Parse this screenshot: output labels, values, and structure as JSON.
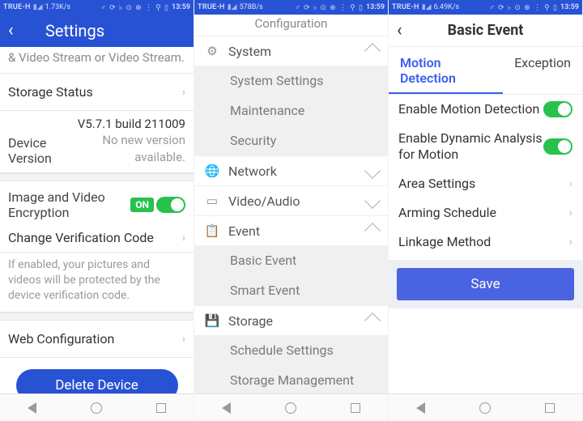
{
  "status_bar": {
    "carrier": "TRUE-H",
    "signal_icon": "▮◢",
    "speeds": [
      "1.73K/s",
      "578B/s",
      "6.49K/s"
    ],
    "icons_right": "♂ ⟳ ♭ ⊙ ⊕ ⋮ ⚲ ▯",
    "time": "13:59"
  },
  "phone1": {
    "header": {
      "title": "Settings"
    },
    "stream_note": "& Video Stream or Video Stream.",
    "storage_status": {
      "label": "Storage Status"
    },
    "device_version": {
      "label": "Device Version",
      "build": "V5.7.1 build 211009",
      "no_update": "No new version available."
    },
    "encryption": {
      "label": "Image and Video Encryption",
      "badge": "ON",
      "on": true
    },
    "change_code": {
      "label": "Change Verification Code"
    },
    "help": "If enabled, your pictures and videos will be protected by the device verification code.",
    "web_config": {
      "label": "Web Configuration"
    },
    "delete_btn": "Delete Device"
  },
  "phone2": {
    "top_cut": "Configuration",
    "groups": [
      {
        "icon": "⚙",
        "label": "System",
        "open": true,
        "items": [
          "System Settings",
          "Maintenance",
          "Security"
        ]
      },
      {
        "icon": "🌐",
        "label": "Network",
        "open": false,
        "items": []
      },
      {
        "icon": "▭",
        "label": "Video/Audio",
        "open": false,
        "items": []
      },
      {
        "icon": "📋",
        "label": "Event",
        "open": true,
        "items": [
          "Basic Event",
          "Smart Event"
        ]
      },
      {
        "icon": "💾",
        "label": "Storage",
        "open": true,
        "items": [
          "Schedule Settings",
          "Storage Management"
        ]
      }
    ]
  },
  "phone3": {
    "header": {
      "title": "Basic Event"
    },
    "tabs": [
      {
        "label": "Motion Detection",
        "active": true
      },
      {
        "label": "Exception",
        "active": false
      }
    ],
    "options": [
      {
        "label": "Enable Motion Detection",
        "type": "toggle",
        "on": true
      },
      {
        "label": "Enable Dynamic Analysis for Motion",
        "type": "toggle",
        "on": true
      },
      {
        "label": "Area Settings",
        "type": "nav"
      },
      {
        "label": "Arming Schedule",
        "type": "nav"
      },
      {
        "label": "Linkage Method",
        "type": "nav"
      }
    ],
    "save_btn": "Save"
  }
}
